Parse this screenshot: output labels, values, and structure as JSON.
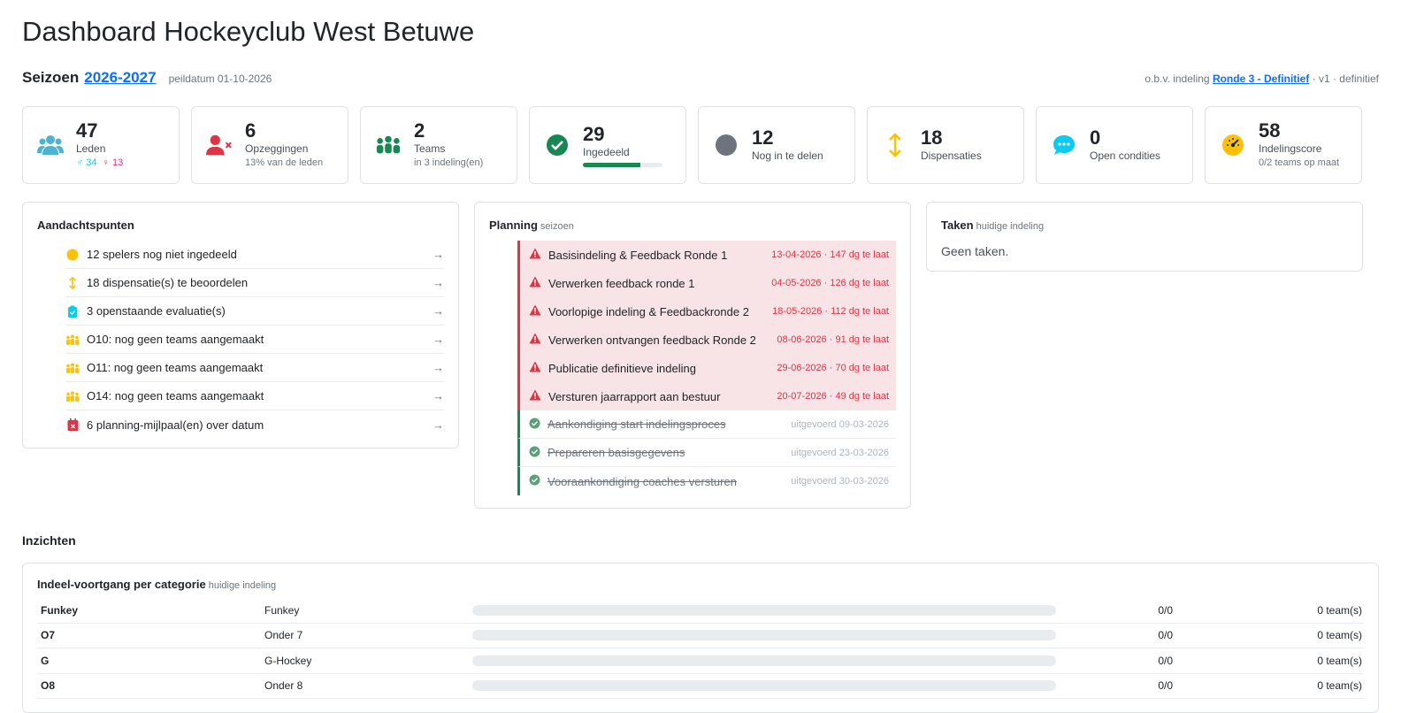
{
  "page": {
    "title": "Dashboard Hockeyclub West Betuwe"
  },
  "season": {
    "label": "Seizoen",
    "value": "2026-2027",
    "peildatum": "peildatum 01-10-2026",
    "basis_prefix": "o.b.v. indeling",
    "basis_link": "Ronde 3 - Definitief",
    "basis_suffix": "· v1 · definitief"
  },
  "stats": [
    {
      "icon": "users-icon",
      "value": "47",
      "label": "Leden",
      "male": "♂ 34",
      "female": "♀ 13"
    },
    {
      "icon": "user-x-icon",
      "value": "6",
      "label": "Opzeggingen",
      "sub": "13% van de leden"
    },
    {
      "icon": "team-icon",
      "value": "2",
      "label": "Teams",
      "sub": "in 3 indeling(en)"
    },
    {
      "icon": "check-circle-icon",
      "value": "29",
      "label": "Ingedeeld",
      "progress": 0.72
    },
    {
      "icon": "circle-icon",
      "value": "12",
      "label": "Nog in te delen"
    },
    {
      "icon": "arrows-vertical-icon",
      "value": "18",
      "label": "Dispensaties"
    },
    {
      "icon": "chat-icon",
      "value": "0",
      "label": "Open condities"
    },
    {
      "icon": "speedometer-icon",
      "value": "58",
      "label": "Indelingscore",
      "sub": "0/2 teams op maat"
    }
  ],
  "colors": {
    "green": "#198754",
    "red": "#dc3545",
    "yellow": "#ffc107",
    "cyan": "#0dcaf0",
    "gray": "#6c757d",
    "blue": "#0d6efd"
  },
  "attention": {
    "title": "Aandachtspunten",
    "items": [
      {
        "icon": "circle-icon",
        "text": "12 spelers nog niet ingedeeld"
      },
      {
        "icon": "arrows-vertical-icon",
        "text": "18 dispensatie(s) te beoordelen"
      },
      {
        "icon": "clipboard-check-icon",
        "text": "3 openstaande evaluatie(s)"
      },
      {
        "icon": "team-icon",
        "text": "O10: nog geen teams aangemaakt"
      },
      {
        "icon": "team-icon",
        "text": "O11: nog geen teams aangemaakt"
      },
      {
        "icon": "team-icon",
        "text": "O14: nog geen teams aangemaakt"
      },
      {
        "icon": "calendar-x-icon",
        "text": "6 planning-mijlpaal(en) over datum"
      }
    ]
  },
  "planning": {
    "title": "Planning",
    "subtitle": "seizoen",
    "items": [
      {
        "status": "late",
        "text": "Basisindeling & Feedback Ronde 1",
        "date": "13-04-2026 · 147 dg te laat"
      },
      {
        "status": "late",
        "text": "Verwerken feedback ronde 1",
        "date": "04-05-2026 · 126 dg te laat"
      },
      {
        "status": "late",
        "text": "Voorlopige indeling & Feedbackronde 2",
        "date": "18-05-2026 · 112 dg te laat"
      },
      {
        "status": "late",
        "text": "Verwerken ontvangen feedback Ronde 2",
        "date": "08-06-2026 · 91 dg te laat"
      },
      {
        "status": "late",
        "text": "Publicatie definitieve indeling",
        "date": "29-06-2026 · 70 dg te laat"
      },
      {
        "status": "late",
        "text": "Versturen jaarrapport aan bestuur",
        "date": "20-07-2026 · 49 dg te laat"
      },
      {
        "status": "done",
        "text": "Aankondiging start indelingsproces",
        "date": "uitgevoerd 09-03-2026"
      },
      {
        "status": "done",
        "text": "Prepareren basisgegevens",
        "date": "uitgevoerd 23-03-2026"
      },
      {
        "status": "done",
        "text": "Vooraankondiging coaches versturen",
        "date": "uitgevoerd 30-03-2026"
      }
    ]
  },
  "tasks": {
    "title": "Taken",
    "subtitle": "huidige indeling",
    "empty": "Geen taken."
  },
  "insights": {
    "title": "Inzichten",
    "card_title": "Indeel-voortgang per categorie",
    "card_subtitle": "huidige indeling",
    "rows": [
      {
        "code": "Funkey",
        "name": "Funkey",
        "ratio": "0/0",
        "teams": "0 team(s)",
        "progress": 0
      },
      {
        "code": "O7",
        "name": "Onder 7",
        "ratio": "0/0",
        "teams": "0 team(s)",
        "progress": 0
      },
      {
        "code": "G",
        "name": "G-Hockey",
        "ratio": "0/0",
        "teams": "0 team(s)",
        "progress": 0
      },
      {
        "code": "O8",
        "name": "Onder 8",
        "ratio": "0/0",
        "teams": "0 team(s)",
        "progress": 0
      }
    ]
  }
}
